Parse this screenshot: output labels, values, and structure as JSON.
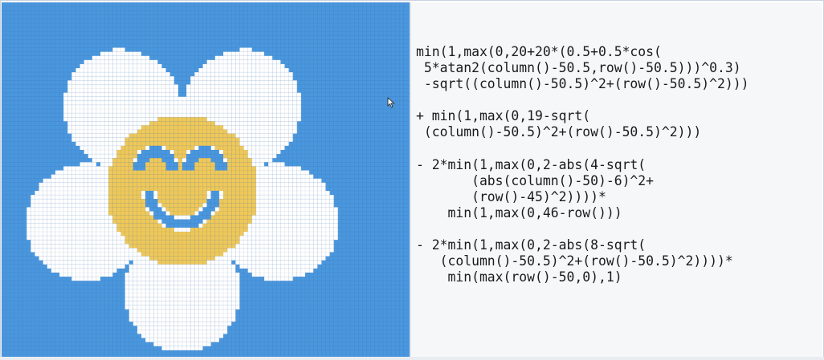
{
  "code": {
    "block1": "min(1,max(0,20+20*(0.5+0.5*cos(\n 5*atan2(column()-50.5,row()-50.5)))^0.3)\n -sqrt((column()-50.5)^2+(row()-50.5)^2)))",
    "block2": "+ min(1,max(0,19-sqrt(\n (column()-50.5)^2+(row()-50.5)^2)))",
    "block3": "- 2*min(1,max(0,2-abs(4-sqrt(\n       (abs(column()-50)-6)^2+\n       (row()-45)^2))))*\n    min(1,max(0,46-row()))",
    "block4": "- 2*min(1,max(0,2-abs(8-sqrt(\n   (column()-50.5)^2+(row()-50.5)^2))))*\n    min(max(row()-50,0),1)"
  },
  "image": {
    "grid_cells": 100,
    "colors": {
      "background": "#4a97de",
      "petal": "#ffffff",
      "center": "#efc85a",
      "features": "#4a97de",
      "grid_line": "rgba(30,60,110,0.12)"
    }
  },
  "icons": {
    "cursor": "mouse-pointer-icon"
  }
}
